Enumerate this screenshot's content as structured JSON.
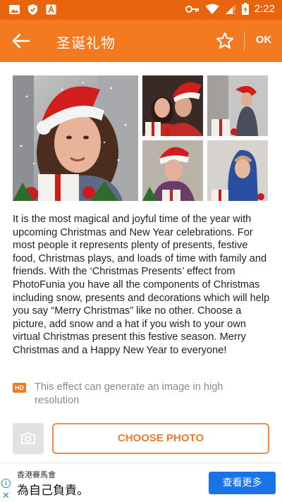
{
  "status_bar": {
    "time": "2:22",
    "left_icons": [
      "image-icon",
      "shield-check-icon",
      "font-icon"
    ],
    "right_icons": [
      "key-icon",
      "wifi-icon",
      "signal-icon",
      "battery-charging-icon"
    ]
  },
  "toolbar": {
    "title": "圣诞礼物",
    "ok_label": "OK",
    "back_icon": "arrow-left-icon",
    "favorite_icon": "star-outline-icon"
  },
  "description": "It is the most magical and joyful time of the year with upcoming Christmas and New Year celebrations. For most people it represents plenty of presents, festive food, Christmas plays, and loads of time with family and friends. With the ‘Christmas Presents’ effect from PhotoFunia you have all the components of Christmas including snow, presents and decorations which will help you say “Merry Christmas” like no other. Choose a picture, add snow and a hat if you wish to your own virtual Christmas present this festive season. Merry Christmas and a Happy New Year to everyone!",
  "hd_note": {
    "badge": "HD",
    "text": "This effect can generate an image in high resolution"
  },
  "actions": {
    "camera_icon": "camera-icon",
    "choose_label": "CHOOSE PHOTO"
  },
  "ad": {
    "small_text": "香港賽馬會",
    "big_text": "為自己負責。",
    "button_label": "查看更多",
    "info_symbol": "i",
    "close_symbol": "✕"
  },
  "colors": {
    "status_bar": "#e8650e",
    "toolbar": "#f47a22",
    "accent": "#f0792a",
    "ad_button": "#1a73e8"
  }
}
